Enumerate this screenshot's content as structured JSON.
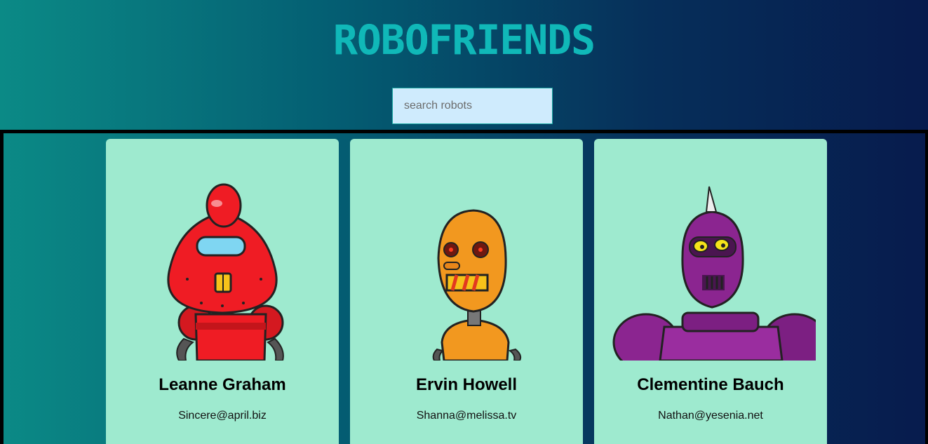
{
  "app": {
    "title": "ROBOFRIENDS"
  },
  "search": {
    "placeholder": "search robots",
    "value": ""
  },
  "robots": [
    {
      "name": "Leanne Graham",
      "email": "Sincere@april.biz",
      "color": "#ef1c24"
    },
    {
      "name": "Ervin Howell",
      "email": "Shanna@melissa.tv",
      "color": "#f2981f"
    },
    {
      "name": "Clementine Bauch",
      "email": "Nathan@yesenia.net",
      "color": "#8b2590"
    }
  ],
  "colors": {
    "card_background": "#9eeacf",
    "title_color": "#19c6c6",
    "search_background": "#cfebfd"
  }
}
